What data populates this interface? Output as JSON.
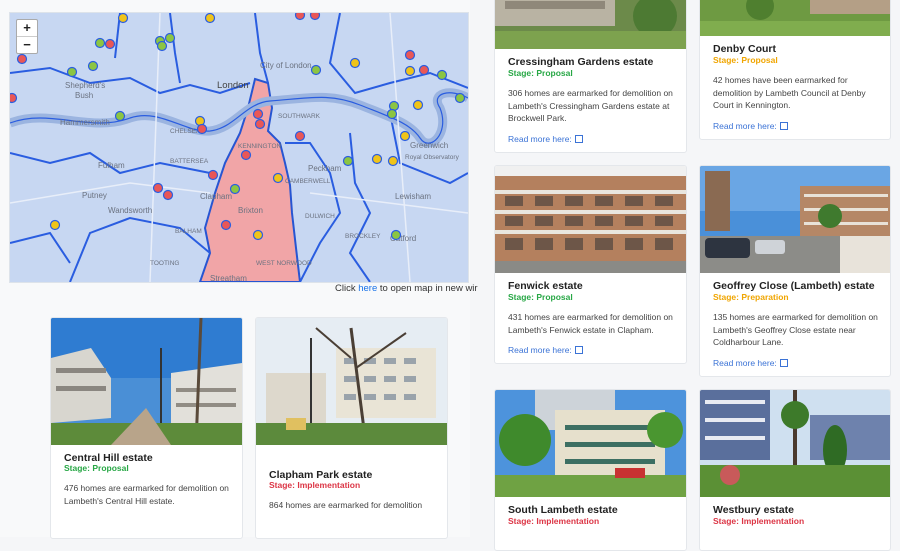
{
  "map": {
    "zoom_in": "+",
    "zoom_out": "−",
    "caption_prefix": "Click",
    "caption_link": "here",
    "caption_suffix": "to open map in new wir",
    "labels": {
      "city": "City of London",
      "london": "London",
      "shepherds": "Shepherd's",
      "bush": "Bush",
      "hammersmith": "Hammersmith",
      "fulham": "Fulham",
      "putney": "Putney",
      "wandsworth": "Wandsworth",
      "clapham": "Clapham",
      "brixton": "Brixton",
      "streatham": "Streatham",
      "peckham": "Peckham",
      "lewisham": "Lewisham",
      "greenwich": "Greenwich",
      "kennington": "KENNINGTON",
      "dulwich": "DULWICH",
      "westnorwood": "WEST NORWOOD",
      "royalobs": "Royal Observatory",
      "catford": "Catford",
      "camberwell": "CAMBERWELL",
      "balham": "BALHAM",
      "tooting": "TOOTING",
      "chelsea": "CHELSEA",
      "battersea": "BATTERSEA",
      "southwark": "SOUTHWARK",
      "brockley": "BROCKLEY"
    }
  },
  "cards": {
    "cressingham": {
      "title": "Cressingham Gardens estate",
      "stage": "Stage: Proposal",
      "desc": "306 homes are earmarked for demolition on Lambeth's Cressingham Gardens estate at Brockwell Park.",
      "more": "Read more here:"
    },
    "denby": {
      "title": "Denby Court",
      "stage": "Stage: Proposal",
      "desc": "42 homes have been earmarked for demolition by Lambeth Council at Denby Court in Kennington.",
      "more": "Read more here:"
    },
    "fenwick": {
      "title": "Fenwick estate",
      "stage": "Stage: Proposal",
      "desc": "431 homes are earmarked for demolition on Lambeth's Fenwick estate in Clapham.",
      "more": "Read more here:"
    },
    "geoffrey": {
      "title": "Geoffrey Close (Lambeth) estate",
      "stage": "Stage: Preparation",
      "desc": "135 homes are earmarked for demolition on Lambeth's Geoffrey Close estate near Coldharbour Lane.",
      "more": "Read more here:"
    },
    "central": {
      "title": "Central Hill estate",
      "stage": "Stage: Proposal",
      "desc": "476 homes are earmarked for demolition on Lambeth's Central Hill estate."
    },
    "clapham": {
      "title": "Clapham Park estate",
      "stage": "Stage: Implementation",
      "desc": "864 homes are earmarked for demolition"
    },
    "southlambeth": {
      "title": "South Lambeth estate",
      "stage": "Stage: Implementation"
    },
    "westbury": {
      "title": "Westbury estate",
      "stage": "Stage: Implementation"
    }
  },
  "colors": {
    "proposal": "#27a745",
    "preparation": "#f0a500",
    "implementation": "#dc3545",
    "link": "#3b73d6"
  }
}
